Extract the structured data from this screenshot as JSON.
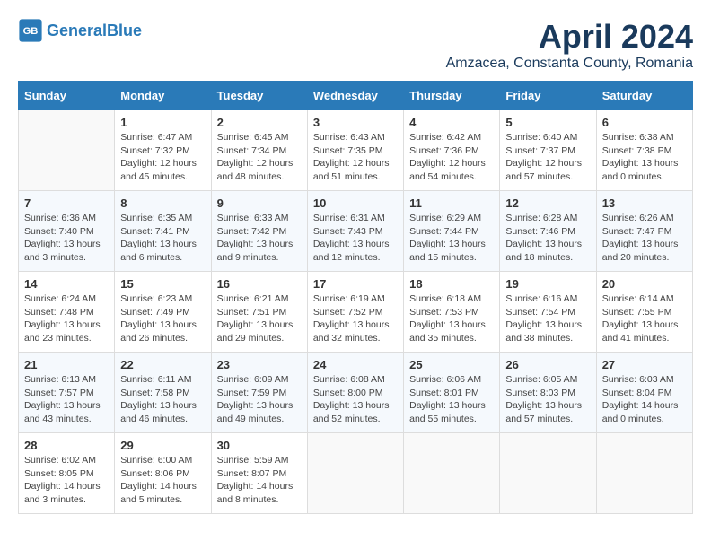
{
  "header": {
    "logo_general": "General",
    "logo_blue": "Blue",
    "title": "April 2024",
    "subtitle": "Amzacea, Constanta County, Romania"
  },
  "weekdays": [
    "Sunday",
    "Monday",
    "Tuesday",
    "Wednesday",
    "Thursday",
    "Friday",
    "Saturday"
  ],
  "weeks": [
    [
      {
        "day": null
      },
      {
        "day": 1,
        "sunrise": "Sunrise: 6:47 AM",
        "sunset": "Sunset: 7:32 PM",
        "daylight": "Daylight: 12 hours and 45 minutes."
      },
      {
        "day": 2,
        "sunrise": "Sunrise: 6:45 AM",
        "sunset": "Sunset: 7:34 PM",
        "daylight": "Daylight: 12 hours and 48 minutes."
      },
      {
        "day": 3,
        "sunrise": "Sunrise: 6:43 AM",
        "sunset": "Sunset: 7:35 PM",
        "daylight": "Daylight: 12 hours and 51 minutes."
      },
      {
        "day": 4,
        "sunrise": "Sunrise: 6:42 AM",
        "sunset": "Sunset: 7:36 PM",
        "daylight": "Daylight: 12 hours and 54 minutes."
      },
      {
        "day": 5,
        "sunrise": "Sunrise: 6:40 AM",
        "sunset": "Sunset: 7:37 PM",
        "daylight": "Daylight: 12 hours and 57 minutes."
      },
      {
        "day": 6,
        "sunrise": "Sunrise: 6:38 AM",
        "sunset": "Sunset: 7:38 PM",
        "daylight": "Daylight: 13 hours and 0 minutes."
      }
    ],
    [
      {
        "day": 7,
        "sunrise": "Sunrise: 6:36 AM",
        "sunset": "Sunset: 7:40 PM",
        "daylight": "Daylight: 13 hours and 3 minutes."
      },
      {
        "day": 8,
        "sunrise": "Sunrise: 6:35 AM",
        "sunset": "Sunset: 7:41 PM",
        "daylight": "Daylight: 13 hours and 6 minutes."
      },
      {
        "day": 9,
        "sunrise": "Sunrise: 6:33 AM",
        "sunset": "Sunset: 7:42 PM",
        "daylight": "Daylight: 13 hours and 9 minutes."
      },
      {
        "day": 10,
        "sunrise": "Sunrise: 6:31 AM",
        "sunset": "Sunset: 7:43 PM",
        "daylight": "Daylight: 13 hours and 12 minutes."
      },
      {
        "day": 11,
        "sunrise": "Sunrise: 6:29 AM",
        "sunset": "Sunset: 7:44 PM",
        "daylight": "Daylight: 13 hours and 15 minutes."
      },
      {
        "day": 12,
        "sunrise": "Sunrise: 6:28 AM",
        "sunset": "Sunset: 7:46 PM",
        "daylight": "Daylight: 13 hours and 18 minutes."
      },
      {
        "day": 13,
        "sunrise": "Sunrise: 6:26 AM",
        "sunset": "Sunset: 7:47 PM",
        "daylight": "Daylight: 13 hours and 20 minutes."
      }
    ],
    [
      {
        "day": 14,
        "sunrise": "Sunrise: 6:24 AM",
        "sunset": "Sunset: 7:48 PM",
        "daylight": "Daylight: 13 hours and 23 minutes."
      },
      {
        "day": 15,
        "sunrise": "Sunrise: 6:23 AM",
        "sunset": "Sunset: 7:49 PM",
        "daylight": "Daylight: 13 hours and 26 minutes."
      },
      {
        "day": 16,
        "sunrise": "Sunrise: 6:21 AM",
        "sunset": "Sunset: 7:51 PM",
        "daylight": "Daylight: 13 hours and 29 minutes."
      },
      {
        "day": 17,
        "sunrise": "Sunrise: 6:19 AM",
        "sunset": "Sunset: 7:52 PM",
        "daylight": "Daylight: 13 hours and 32 minutes."
      },
      {
        "day": 18,
        "sunrise": "Sunrise: 6:18 AM",
        "sunset": "Sunset: 7:53 PM",
        "daylight": "Daylight: 13 hours and 35 minutes."
      },
      {
        "day": 19,
        "sunrise": "Sunrise: 6:16 AM",
        "sunset": "Sunset: 7:54 PM",
        "daylight": "Daylight: 13 hours and 38 minutes."
      },
      {
        "day": 20,
        "sunrise": "Sunrise: 6:14 AM",
        "sunset": "Sunset: 7:55 PM",
        "daylight": "Daylight: 13 hours and 41 minutes."
      }
    ],
    [
      {
        "day": 21,
        "sunrise": "Sunrise: 6:13 AM",
        "sunset": "Sunset: 7:57 PM",
        "daylight": "Daylight: 13 hours and 43 minutes."
      },
      {
        "day": 22,
        "sunrise": "Sunrise: 6:11 AM",
        "sunset": "Sunset: 7:58 PM",
        "daylight": "Daylight: 13 hours and 46 minutes."
      },
      {
        "day": 23,
        "sunrise": "Sunrise: 6:09 AM",
        "sunset": "Sunset: 7:59 PM",
        "daylight": "Daylight: 13 hours and 49 minutes."
      },
      {
        "day": 24,
        "sunrise": "Sunrise: 6:08 AM",
        "sunset": "Sunset: 8:00 PM",
        "daylight": "Daylight: 13 hours and 52 minutes."
      },
      {
        "day": 25,
        "sunrise": "Sunrise: 6:06 AM",
        "sunset": "Sunset: 8:01 PM",
        "daylight": "Daylight: 13 hours and 55 minutes."
      },
      {
        "day": 26,
        "sunrise": "Sunrise: 6:05 AM",
        "sunset": "Sunset: 8:03 PM",
        "daylight": "Daylight: 13 hours and 57 minutes."
      },
      {
        "day": 27,
        "sunrise": "Sunrise: 6:03 AM",
        "sunset": "Sunset: 8:04 PM",
        "daylight": "Daylight: 14 hours and 0 minutes."
      }
    ],
    [
      {
        "day": 28,
        "sunrise": "Sunrise: 6:02 AM",
        "sunset": "Sunset: 8:05 PM",
        "daylight": "Daylight: 14 hours and 3 minutes."
      },
      {
        "day": 29,
        "sunrise": "Sunrise: 6:00 AM",
        "sunset": "Sunset: 8:06 PM",
        "daylight": "Daylight: 14 hours and 5 minutes."
      },
      {
        "day": 30,
        "sunrise": "Sunrise: 5:59 AM",
        "sunset": "Sunset: 8:07 PM",
        "daylight": "Daylight: 14 hours and 8 minutes."
      },
      {
        "day": null
      },
      {
        "day": null
      },
      {
        "day": null
      },
      {
        "day": null
      }
    ]
  ]
}
